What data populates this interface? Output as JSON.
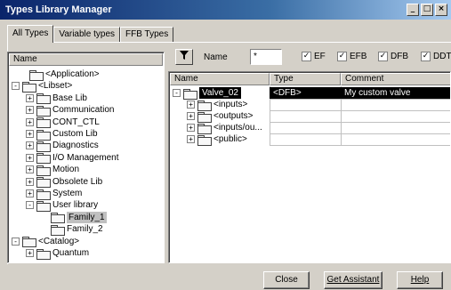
{
  "window": {
    "title": "Types Library Manager",
    "controls": [
      "_",
      "□",
      "×"
    ]
  },
  "tabs": [
    {
      "label": "All Types",
      "active": true
    },
    {
      "label": "Variable types",
      "active": false
    },
    {
      "label": "FFB Types",
      "active": false
    }
  ],
  "tree": {
    "header": "Name",
    "items": [
      {
        "label": "<Application>",
        "expander": "",
        "selected": false
      },
      {
        "label": "<Libset>",
        "expander": "-",
        "selected": false
      },
      {
        "label": "Base Lib",
        "expander": "+",
        "selected": false
      },
      {
        "label": "Communication",
        "expander": "+",
        "selected": false
      },
      {
        "label": "CONT_CTL",
        "expander": "+",
        "selected": false
      },
      {
        "label": "Custom Lib",
        "expander": "+",
        "selected": false
      },
      {
        "label": "Diagnostics",
        "expander": "+",
        "selected": false
      },
      {
        "label": "I/O Management",
        "expander": "+",
        "selected": false
      },
      {
        "label": "Motion",
        "expander": "+",
        "selected": false
      },
      {
        "label": "Obsolete Lib",
        "expander": "+",
        "selected": false
      },
      {
        "label": "System",
        "expander": "+",
        "selected": false
      },
      {
        "label": "User library",
        "expander": "-",
        "selected": false
      },
      {
        "label": "Family_1",
        "expander": "",
        "selected": true
      },
      {
        "label": "Family_2",
        "expander": "",
        "selected": false
      },
      {
        "label": "<Catalog>",
        "expander": "-",
        "selected": false
      },
      {
        "label": "Quantum",
        "expander": "+",
        "selected": false
      }
    ]
  },
  "filter": {
    "name_label": "Name",
    "name_value": "*",
    "checkboxes": [
      {
        "label": "EF",
        "checked": true
      },
      {
        "label": "EFB",
        "checked": true
      },
      {
        "label": "DFB",
        "checked": true
      },
      {
        "label": "DDT",
        "checked": true
      }
    ]
  },
  "table": {
    "columns": [
      "Name",
      "Type",
      "Comment"
    ],
    "rows": [
      {
        "name": "Valve_02",
        "type": "<DFB>",
        "comment": "My custom valve",
        "expander": "-",
        "selected": true
      },
      {
        "name": "<inputs>",
        "type": "",
        "comment": "",
        "expander": "+",
        "selected": false
      },
      {
        "name": "<outputs>",
        "type": "",
        "comment": "",
        "expander": "+",
        "selected": false
      },
      {
        "name": "<inputs/ou...",
        "type": "",
        "comment": "",
        "expander": "+",
        "selected": false
      },
      {
        "name": "<public>",
        "type": "",
        "comment": "",
        "expander": "+",
        "selected": false
      }
    ]
  },
  "buttons": {
    "close": "Close",
    "get_assistant": "Get Assistant",
    "help": "Help"
  },
  "icons": {
    "filter": "funnel-icon",
    "folder": "folder-icon"
  }
}
